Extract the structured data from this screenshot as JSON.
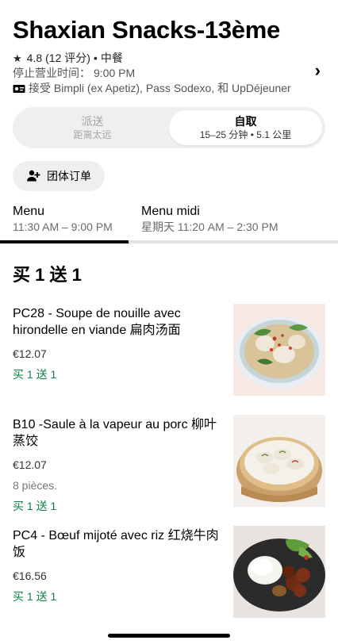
{
  "restaurant": {
    "name": "Shaxian Snacks-13ème",
    "rating": "4.8",
    "rating_count": "(12 评分)",
    "separator": "•",
    "cuisine": "中餐",
    "hours_label": "停止营业时间：",
    "hours_value": "9:00 PM",
    "payments": "接受 Bimpli (ex Apetiz), Pass Sodexo, 和 UpDéjeuner"
  },
  "mode_toggle": {
    "delivery_label": "派送",
    "delivery_sub": "距离太远",
    "pickup_label": "自取",
    "pickup_sub": "15–25 分钟 • 5.1 公里"
  },
  "group_order_label": "团体订单",
  "tabs": [
    {
      "name": "Menu",
      "hours": "11:30 AM – 9:00 PM"
    },
    {
      "name": "Menu midi",
      "hours": "星期天 11:20 AM – 2:30 PM"
    }
  ],
  "section_title": "买 1 送 1",
  "items": [
    {
      "name": "PC28 - Soupe de nouille avec hirondelle en viande 扁肉汤面",
      "price": "€12.07",
      "description": "",
      "promo": "买 1 送 1"
    },
    {
      "name": "B10 -Saule à la vapeur au porc 柳叶蒸饺",
      "price": "€12.07",
      "description": "8 pièces.",
      "promo": "买 1 送 1"
    },
    {
      "name": "PC4 - Bœuf mijoté avec riz 红烧牛肉饭",
      "price": "€16.56",
      "description": "",
      "promo": "买 1 送 1"
    }
  ],
  "colors": {
    "promo_green": "#0e8345",
    "toggle_bg": "#efefef",
    "tab_indicator": "#000000"
  }
}
